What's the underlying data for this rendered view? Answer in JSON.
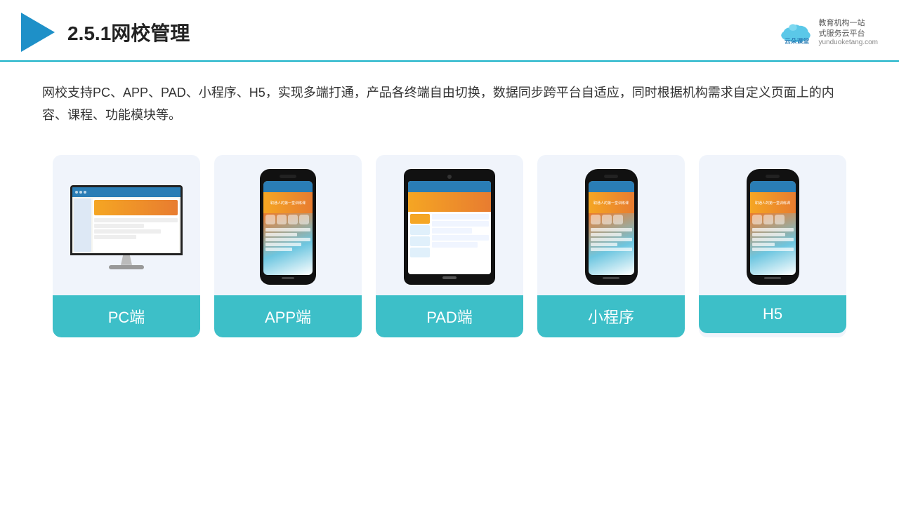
{
  "header": {
    "title": "2.5.1网校管理",
    "brand": {
      "name": "云朵课堂",
      "url": "yunduoketang.com",
      "slogan": "教育机构一站\n式服务云平台"
    }
  },
  "description": {
    "text": "网校支持PC、APP、PAD、小程序、H5，实现多端打通，产品各终端自由切换，数据同步跨平台自适应，同时根据机构需求自定义页面上的内容、课程、功能模块等。"
  },
  "cards": [
    {
      "id": "pc",
      "label": "PC端"
    },
    {
      "id": "app",
      "label": "APP端"
    },
    {
      "id": "pad",
      "label": "PAD端"
    },
    {
      "id": "mini",
      "label": "小程序"
    },
    {
      "id": "h5",
      "label": "H5"
    }
  ],
  "colors": {
    "accent": "#1ab2c8",
    "teal": "#3dbfc8",
    "headerBorder": "#1ab2c8"
  }
}
